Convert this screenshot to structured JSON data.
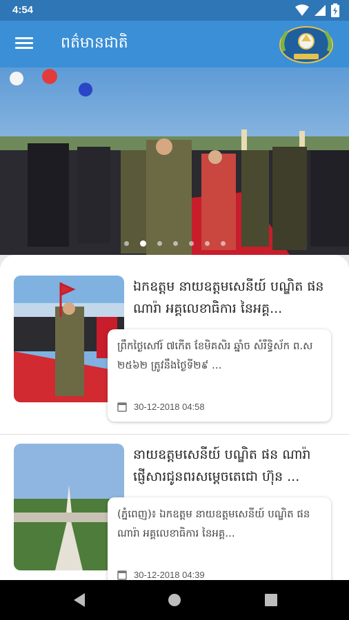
{
  "status_bar": {
    "time": "4:54"
  },
  "app_bar": {
    "title": "ពត៌មានជាតិ"
  },
  "colors": {
    "status_bar": "#2f76b6",
    "app_bar": "#3b8fd6",
    "nav_bar": "#000000",
    "card_bg": "#ffffff"
  },
  "carousel": {
    "slide_count": 7,
    "active_index": 1
  },
  "articles": [
    {
      "headline": "ឯកឧត្តម នាយឧត្តមសេនីយ៍ បណ្ឌិត ផន ណារ៉ា អគ្គលេខាធិការ នៃអគ្គ...",
      "summary": "ព្រឹកថ្ងៃសៅរ៍ ៧កើត ខែមិគសិរ ឆ្នាំច សំរឹទ្ធិស័ក ព.ស ២៥៦២ ត្រូវនឹងថ្ងៃទី២៩ ...",
      "date": "30-12-2018 04:58"
    },
    {
      "headline": "នាយឧត្តមសេនីយ៍ បណ្ឌិត ផន ណារ៉ា ផ្ញើសារជូនពរសម្តេចតេជោ ហ៊ុន ...",
      "summary": "(ភ្នំពេញ)៖ ឯកឧត្តម នាយឧត្តមសេនីយ៍ បណ្ឌិត ផន ណារ៉ា អគ្គលេខាធិការ នៃអគ្គ...",
      "date": "30-12-2018 04:39"
    }
  ]
}
